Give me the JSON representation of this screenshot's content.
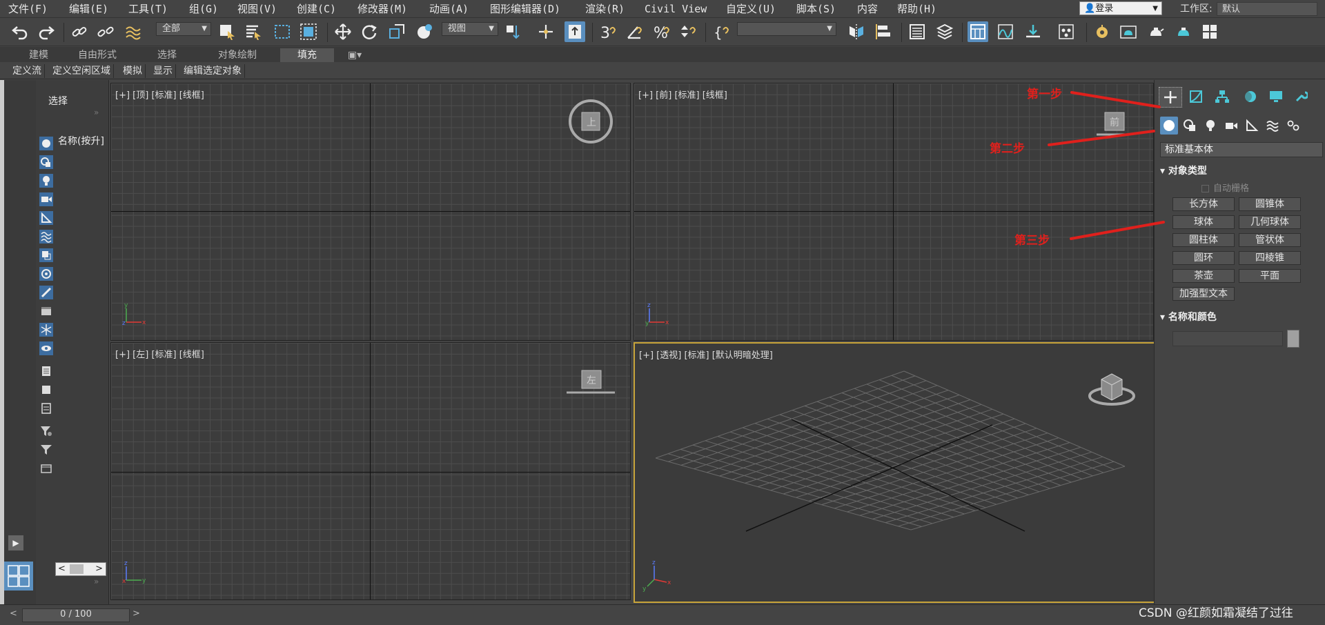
{
  "menu": {
    "items": [
      "文件(F)",
      "编辑(E)",
      "工具(T)",
      "组(G)",
      "视图(V)",
      "创建(C)",
      "修改器(M)",
      "动画(A)",
      "图形编辑器(D)",
      "渲染(R)",
      "Civil View",
      "自定义(U)",
      "脚本(S)",
      "内容",
      "帮助(H)"
    ],
    "login": "登录",
    "workspace_label": "工作区:",
    "workspace_value": "默认"
  },
  "toolbar": {
    "selection_filter": "全部",
    "ref_coord": "视图"
  },
  "ribbon": {
    "tabs": [
      "建模",
      "自由形式",
      "选择",
      "对象绘制",
      "填充"
    ],
    "selected": "填充",
    "subtabs": [
      "定义流",
      "定义空闲区域",
      "模拟",
      "显示",
      "编辑选定对象"
    ]
  },
  "scene_explorer": {
    "select_label": "选择",
    "name_column": "名称(按升]"
  },
  "viewports": {
    "top": "[+] [顶] [标准] [线框]",
    "front": "[+] [前] [标准] [线框]",
    "left": "[+] [左] [标准] [线框]",
    "perspective": "[+] [透视] [标准] [默认明暗处理]",
    "top_cube": "上",
    "front_cube": "前",
    "left_cube": "左"
  },
  "command_panel": {
    "category": "标准基本体",
    "object_type_header": "对象类型",
    "autogrid": "自动栅格",
    "buttons": [
      "长方体",
      "圆锥体",
      "球体",
      "几何球体",
      "圆柱体",
      "管状体",
      "圆环",
      "四棱锥",
      "茶壶",
      "平面",
      "加强型文本"
    ],
    "name_color_header": "名称和颜色"
  },
  "annotations": {
    "step1": "第一步",
    "step2": "第二步",
    "step3": "第三步"
  },
  "timeline": {
    "value": "0 / 100"
  },
  "watermark": "CSDN @红颜如霜凝结了过往"
}
